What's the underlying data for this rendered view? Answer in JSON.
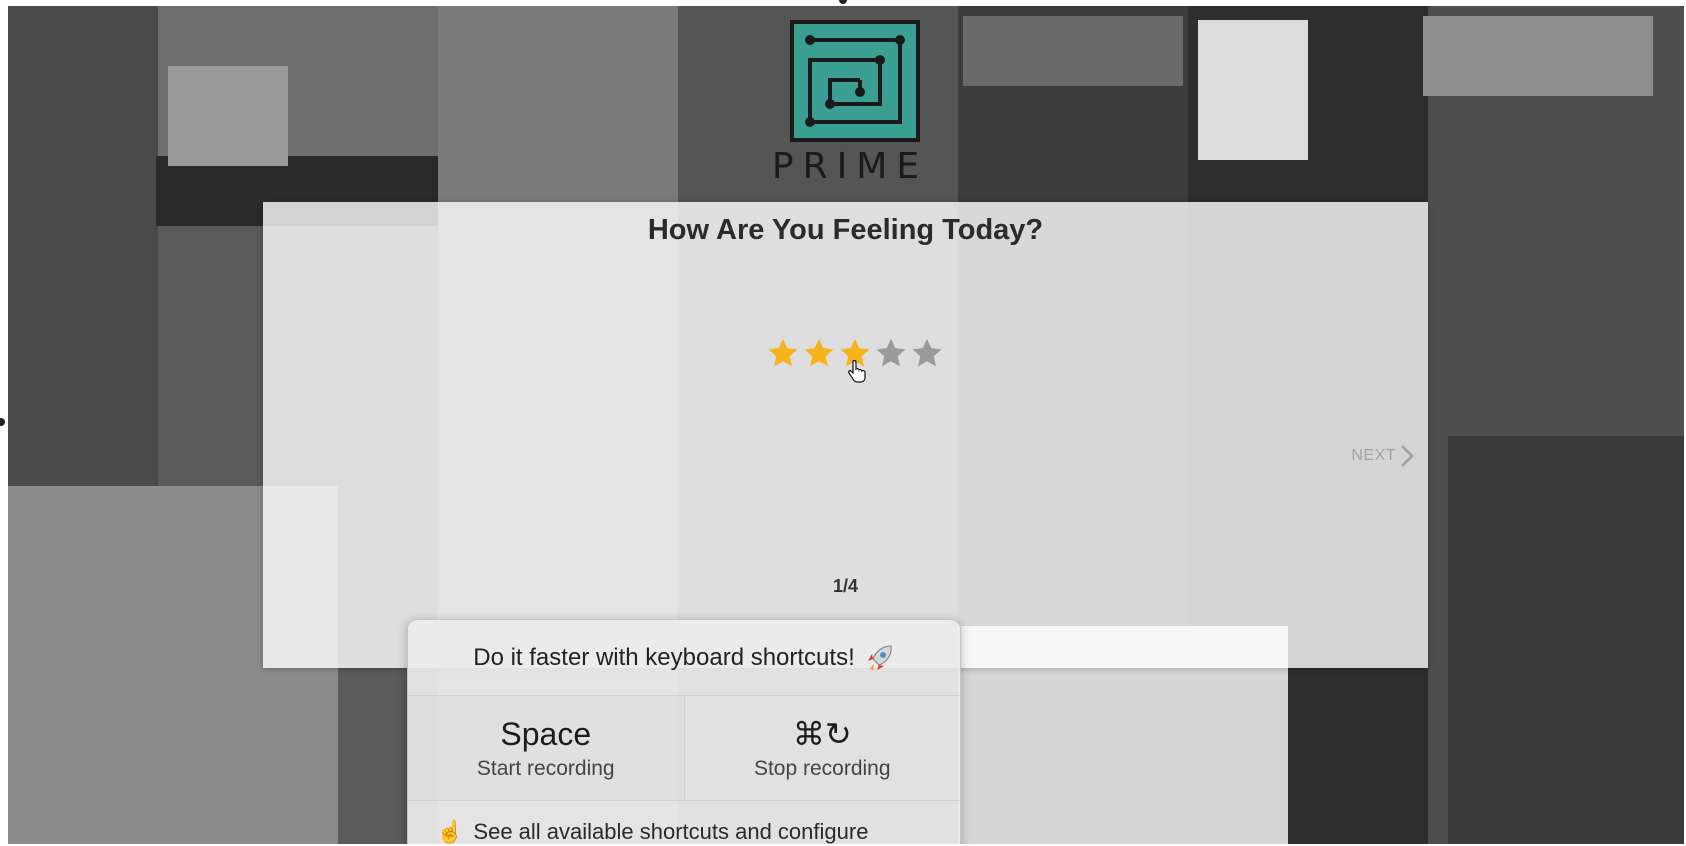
{
  "logo": {
    "wordmark": "PRIME",
    "color": "#3a9e93"
  },
  "survey": {
    "title": "How Are You Feeling Today?",
    "rating": {
      "value": 3,
      "max": 5,
      "filled_color": "#f5b41c",
      "empty_color": "#9a9a9a"
    },
    "next_label": "NEXT",
    "counter": "1/4"
  },
  "shortcuts_popup": {
    "header": "Do it faster with keyboard shortcuts!",
    "header_icon": "rocket-icon",
    "shortcuts": [
      {
        "key": "Space",
        "description": "Start recording"
      },
      {
        "key": "⌘↻",
        "description": "Stop recording"
      }
    ],
    "footer_label": "See all available shortcuts and configure",
    "footer_icon": "pointing-hand-icon"
  }
}
